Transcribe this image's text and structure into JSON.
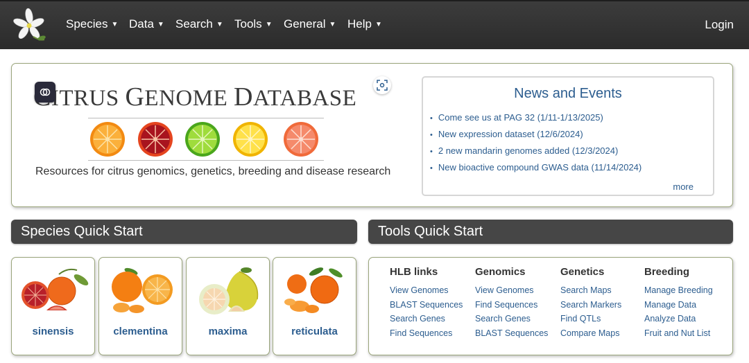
{
  "nav": {
    "items": [
      {
        "label": "Species"
      },
      {
        "label": "Data"
      },
      {
        "label": "Search"
      },
      {
        "label": "Tools"
      },
      {
        "label": "General"
      },
      {
        "label": "Help"
      }
    ],
    "login": "Login"
  },
  "hero": {
    "title_first_cap": "C",
    "title_rest_1": "ITRUS ",
    "title_cap_2": "G",
    "title_rest_2": "ENOME ",
    "title_cap_3": "D",
    "title_rest_3": "ATABASE",
    "tagline": "Resources for citrus genomics, genetics, breeding and disease research"
  },
  "news": {
    "title": "News and Events",
    "items": [
      "Come see us at PAG 32 (1/11-1/13/2025)",
      "New expression dataset (12/6/2024)",
      "2 new mandarin genomes added (12/3/2024)",
      "New bioactive compound GWAS data (11/14/2024)"
    ],
    "more": "more"
  },
  "species_header": "Species Quick Start",
  "tools_header": "Tools Quick Start",
  "species": [
    {
      "label": "sinensis"
    },
    {
      "label": "clementina"
    },
    {
      "label": "maxima"
    },
    {
      "label": "reticulata"
    }
  ],
  "tools": [
    {
      "heading": "HLB links",
      "links": [
        "View Genomes",
        "BLAST Sequences",
        "Search Genes",
        "Find Sequences"
      ]
    },
    {
      "heading": "Genomics",
      "links": [
        "View Genomes",
        "Find Sequences",
        "Search Genes",
        "BLAST Sequences"
      ]
    },
    {
      "heading": "Genetics",
      "links": [
        "Search Maps",
        "Search Markers",
        "Find QTLs",
        "Compare Maps"
      ]
    },
    {
      "heading": "Breeding",
      "links": [
        "Manage Breeding",
        "Manage Data",
        "Analyze Data",
        "Fruit and Nut List"
      ]
    }
  ],
  "colors": {
    "navbar": "#333333",
    "link": "#2c5d8f",
    "panel_border": "#9aa57b",
    "section_header": "#464646"
  }
}
